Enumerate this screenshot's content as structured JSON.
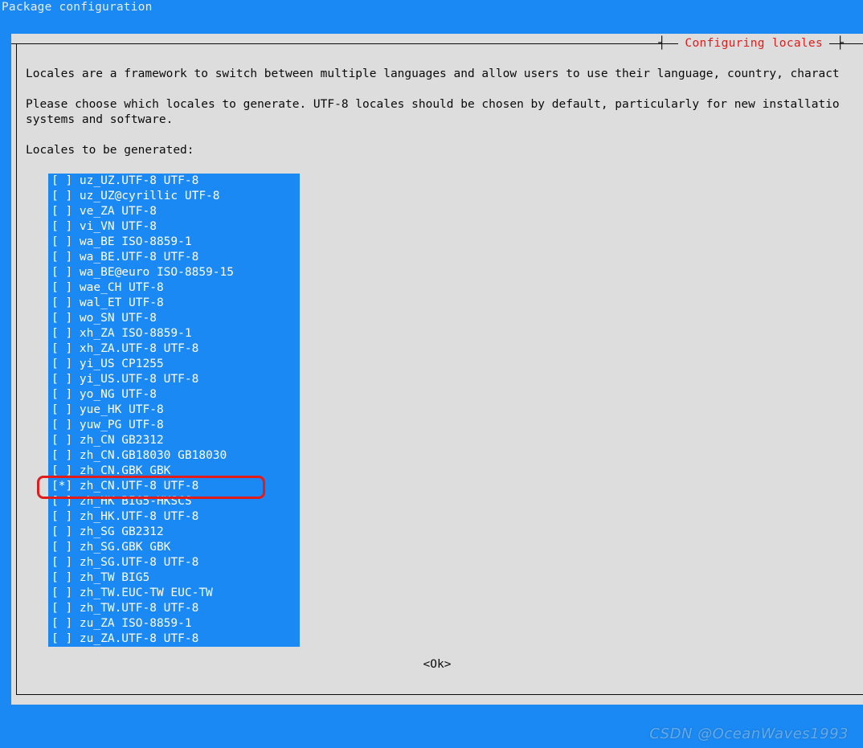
{
  "window_title": "Package configuration",
  "dialog": {
    "title": "Configuring locales",
    "ok_label": "<Ok>",
    "description_line1": "Locales are a framework to switch between multiple languages and allow users to use their language, country, charact",
    "description_line2": "Please choose which locales to generate. UTF-8 locales should be chosen by default, particularly for new installatio",
    "description_line3": "systems and software.",
    "prompt": "Locales to be generated:",
    "highlight_index": 20,
    "items": [
      {
        "checked": false,
        "label": "uz_UZ.UTF-8 UTF-8"
      },
      {
        "checked": false,
        "label": "uz_UZ@cyrillic UTF-8"
      },
      {
        "checked": false,
        "label": "ve_ZA UTF-8"
      },
      {
        "checked": false,
        "label": "vi_VN UTF-8"
      },
      {
        "checked": false,
        "label": "wa_BE ISO-8859-1"
      },
      {
        "checked": false,
        "label": "wa_BE.UTF-8 UTF-8"
      },
      {
        "checked": false,
        "label": "wa_BE@euro ISO-8859-15"
      },
      {
        "checked": false,
        "label": "wae_CH UTF-8"
      },
      {
        "checked": false,
        "label": "wal_ET UTF-8"
      },
      {
        "checked": false,
        "label": "wo_SN UTF-8"
      },
      {
        "checked": false,
        "label": "xh_ZA ISO-8859-1"
      },
      {
        "checked": false,
        "label": "xh_ZA.UTF-8 UTF-8"
      },
      {
        "checked": false,
        "label": "yi_US CP1255"
      },
      {
        "checked": false,
        "label": "yi_US.UTF-8 UTF-8"
      },
      {
        "checked": false,
        "label": "yo_NG UTF-8"
      },
      {
        "checked": false,
        "label": "yue_HK UTF-8"
      },
      {
        "checked": false,
        "label": "yuw_PG UTF-8"
      },
      {
        "checked": false,
        "label": "zh_CN GB2312"
      },
      {
        "checked": false,
        "label": "zh_CN.GB18030 GB18030"
      },
      {
        "checked": false,
        "label": "zh_CN.GBK GBK"
      },
      {
        "checked": true,
        "label": "zh_CN.UTF-8 UTF-8"
      },
      {
        "checked": false,
        "label": "zh_HK BIG5-HKSCS"
      },
      {
        "checked": false,
        "label": "zh_HK.UTF-8 UTF-8"
      },
      {
        "checked": false,
        "label": "zh_SG GB2312"
      },
      {
        "checked": false,
        "label": "zh_SG.GBK GBK"
      },
      {
        "checked": false,
        "label": "zh_SG.UTF-8 UTF-8"
      },
      {
        "checked": false,
        "label": "zh_TW BIG5"
      },
      {
        "checked": false,
        "label": "zh_TW.EUC-TW EUC-TW"
      },
      {
        "checked": false,
        "label": "zh_TW.UTF-8 UTF-8"
      },
      {
        "checked": false,
        "label": "zu_ZA ISO-8859-1"
      },
      {
        "checked": false,
        "label": "zu_ZA.UTF-8 UTF-8"
      }
    ]
  },
  "watermark": "CSDN @OceanWaves1993"
}
